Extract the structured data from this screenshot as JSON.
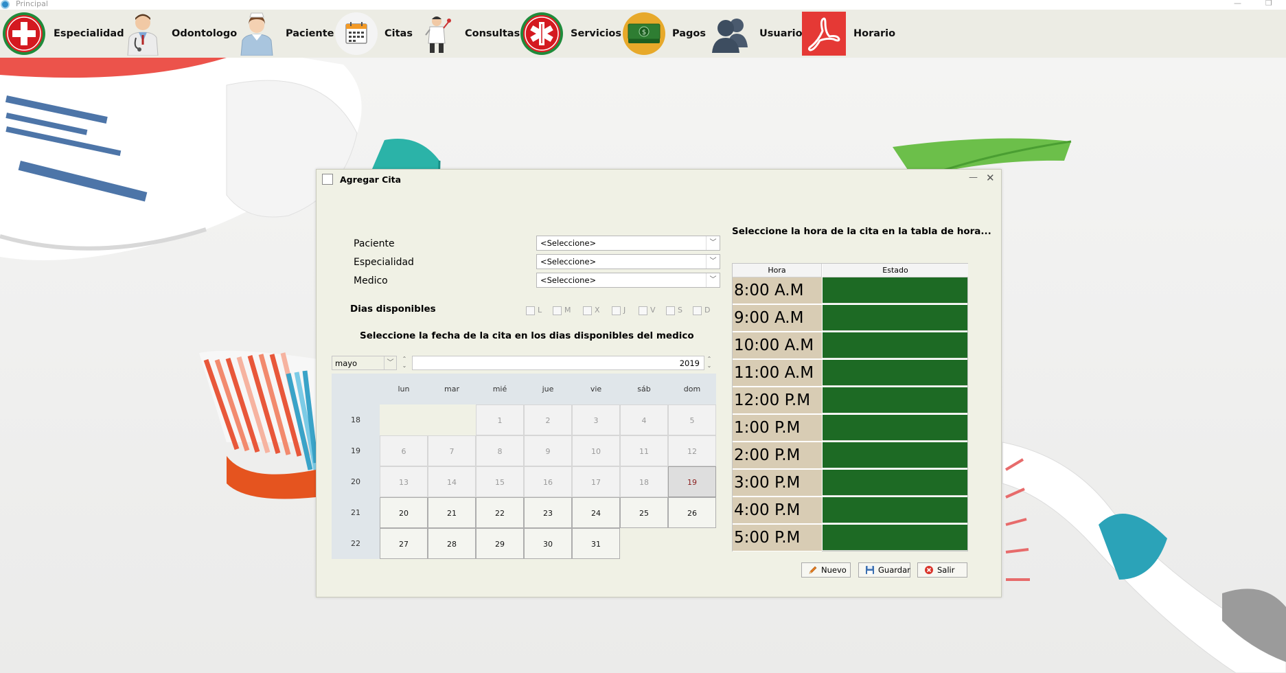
{
  "window": {
    "title": "Principal"
  },
  "menu": [
    {
      "label": "Especialidad",
      "icon": "red-cross-icon"
    },
    {
      "label": "Odontologo",
      "icon": "doctor-icon"
    },
    {
      "label": "Paciente",
      "icon": "nurse-icon"
    },
    {
      "label": "Citas",
      "icon": "calendar-icon"
    },
    {
      "label": "Consultas",
      "icon": "dentist-icon"
    },
    {
      "label": "Servicios",
      "icon": "medical-star-icon"
    },
    {
      "label": "Pagos",
      "icon": "money-icon"
    },
    {
      "label": "Usuario",
      "icon": "users-icon"
    },
    {
      "label": "Horario",
      "icon": "pdf-icon"
    }
  ],
  "dialog": {
    "title": "Agregar Cita",
    "fields": [
      {
        "label": "Paciente",
        "value": "<Seleccione>"
      },
      {
        "label": "Especialidad",
        "value": "<Seleccione>"
      },
      {
        "label": "Medico",
        "value": "<Seleccione>"
      }
    ],
    "dias_label": "Dias disponibles",
    "days": [
      "L",
      "M",
      "X",
      "J",
      "V",
      "S",
      "D"
    ],
    "fecha_instruction": "Seleccione la fecha de la cita en los dias disponibles del medico",
    "calendar": {
      "month": "mayo",
      "year": "2019",
      "weekdays": [
        "lun",
        "mar",
        "mié",
        "jue",
        "vie",
        "sáb",
        "dom"
      ],
      "weeks": [
        {
          "week": "18",
          "days": [
            "",
            "",
            "1",
            "2",
            "3",
            "4",
            "5"
          ]
        },
        {
          "week": "19",
          "days": [
            "6",
            "7",
            "8",
            "9",
            "10",
            "11",
            "12"
          ]
        },
        {
          "week": "20",
          "days": [
            "13",
            "14",
            "15",
            "16",
            "17",
            "18",
            "19"
          ]
        },
        {
          "week": "21",
          "days": [
            "20",
            "21",
            "22",
            "23",
            "24",
            "25",
            "26"
          ]
        },
        {
          "week": "22",
          "days": [
            "27",
            "28",
            "29",
            "30",
            "31",
            "",
            ""
          ]
        }
      ],
      "today": "19"
    },
    "hora_instruction": "Seleccione la hora de la cita en la tabla de hora...",
    "table": {
      "headers": [
        "Hora",
        "Estado"
      ],
      "rows": [
        "8:00 A.M",
        "9:00 A.M",
        "10:00 A.M",
        "11:00 A.M",
        "12:00 P.M",
        "1:00 P.M",
        "2:00 P.M",
        "3:00 P.M",
        "4:00 P.M",
        "5:00 P.M"
      ],
      "status_color": "#1d6a24",
      "hour_color": "#d8ccb4"
    },
    "buttons": {
      "nuevo": "Nuevo",
      "guardar": "Guardar",
      "salir": "Salir"
    }
  }
}
